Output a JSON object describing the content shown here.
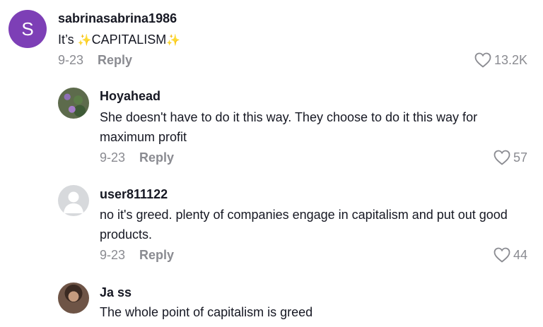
{
  "comments": [
    {
      "username": "sabrinasabrina1986",
      "avatar_letter": "S",
      "text_prefix": "It’s ",
      "text_main": "CAPITALISM",
      "date": "9-23",
      "reply_label": "Reply",
      "likes": "13.2K"
    },
    {
      "username": "Hoyahead",
      "text": "She doesn't have to do it this way. They choose to do it this way for maximum profit",
      "date": "9-23",
      "reply_label": "Reply",
      "likes": "57"
    },
    {
      "username": "user811122",
      "text": "no it's greed. plenty of companies engage in capitalism and put out good products.",
      "date": "9-23",
      "reply_label": "Reply",
      "likes": "44"
    },
    {
      "username": "Ja ss",
      "text": "The whole point of capitalism is greed"
    }
  ],
  "icons": {
    "like": "heart-icon",
    "sparkle": "sparkle-icon",
    "default_avatar": "user-icon"
  },
  "colors": {
    "avatar_purple": "#7d3fb6",
    "meta_gray": "#8a8b91",
    "text_dark": "#161823",
    "sparkle_gold": "#f0c44c"
  }
}
